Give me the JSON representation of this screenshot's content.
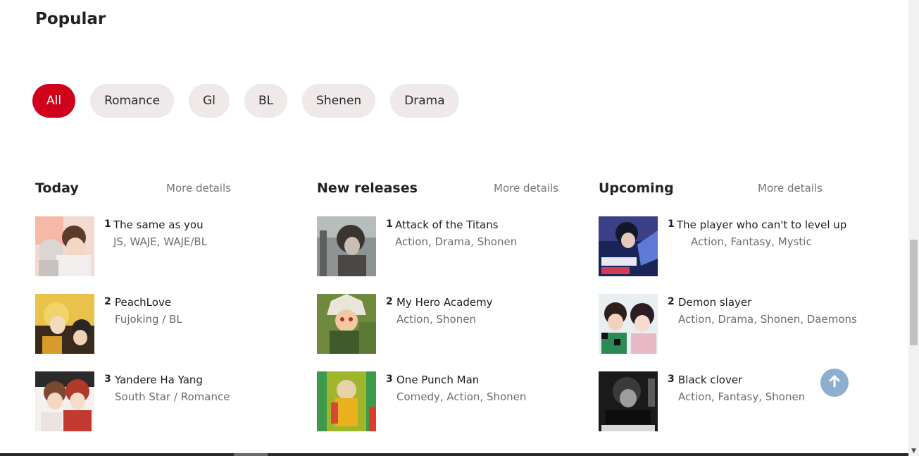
{
  "page": {
    "title": "Popular"
  },
  "filters": [
    {
      "label": "All",
      "active": true
    },
    {
      "label": "Romance",
      "active": false
    },
    {
      "label": "Gl",
      "active": false
    },
    {
      "label": "BL",
      "active": false
    },
    {
      "label": "Shenen",
      "active": false
    },
    {
      "label": "Drama",
      "active": false
    }
  ],
  "sections": {
    "today": {
      "title": "Today",
      "more": "More details",
      "items": [
        {
          "rank": "1",
          "title": "The same as you",
          "subtitle": "JS, WAJE, WAJE/BL"
        },
        {
          "rank": "2",
          "title": "PeachLove",
          "subtitle": "Fujoking / BL"
        },
        {
          "rank": "3",
          "title": "Yandere Ha Yang",
          "subtitle": "South Star / Romance"
        }
      ]
    },
    "new_releases": {
      "title": "New releases",
      "more": "More details",
      "items": [
        {
          "rank": "1",
          "title": "Attack of the Titans",
          "subtitle": "Action, Drama, Shonen"
        },
        {
          "rank": "2",
          "title": "My Hero Academy",
          "subtitle": "Action, Shonen"
        },
        {
          "rank": "3",
          "title": "One Punch Man",
          "subtitle": "Comedy, Action, Shonen"
        }
      ]
    },
    "upcoming": {
      "title": "Upcoming",
      "more": "More details",
      "items": [
        {
          "rank": "1",
          "title": "The player who can't to level up",
          "subtitle": "Action, Fantasy, Mystic"
        },
        {
          "rank": "2",
          "title": "Demon slayer",
          "subtitle": "Action, Drama, Shonen, Daemons"
        },
        {
          "rank": "3",
          "title": "Black clover",
          "subtitle": "Action, Fantasy, Shonen"
        }
      ]
    }
  },
  "icons": {
    "scroll_top": "arrow-up-icon"
  },
  "colors": {
    "accent": "#d0021b",
    "chip_bg": "#efe9e9",
    "to_top_bg": "#8eaed0"
  }
}
